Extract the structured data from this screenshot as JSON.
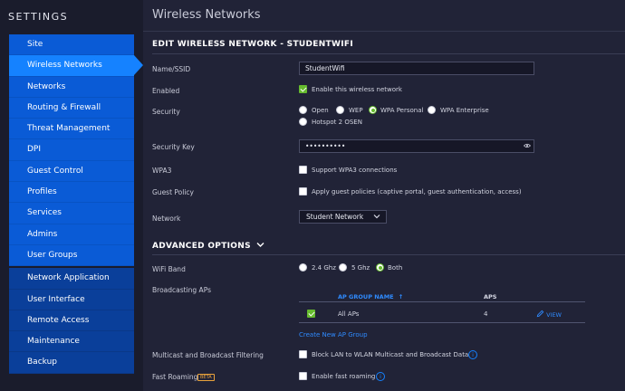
{
  "sidebar": {
    "title": "SETTINGS",
    "items": [
      {
        "label": "Site"
      },
      {
        "label": "Wireless Networks"
      },
      {
        "label": "Networks"
      },
      {
        "label": "Routing & Firewall"
      },
      {
        "label": "Threat Management"
      },
      {
        "label": "DPI"
      },
      {
        "label": "Guest Control"
      },
      {
        "label": "Profiles"
      },
      {
        "label": "Services"
      },
      {
        "label": "Admins"
      },
      {
        "label": "User Groups"
      },
      {
        "label": "Network Application"
      },
      {
        "label": "User Interface"
      },
      {
        "label": "Remote Access"
      },
      {
        "label": "Maintenance"
      },
      {
        "label": "Backup"
      }
    ]
  },
  "page": {
    "title": "Wireless Networks",
    "section_title": "EDIT WIRELESS NETWORK - STUDENTWIFI",
    "advanced_title": "ADVANCED OPTIONS"
  },
  "form": {
    "ssid": {
      "label": "Name/SSID",
      "value": "StudentWifi"
    },
    "enabled": {
      "label": "Enabled",
      "checkbox_label": "Enable this wireless network",
      "checked": true
    },
    "security": {
      "label": "Security",
      "options": [
        "Open",
        "WEP",
        "WPA Personal",
        "WPA Enterprise",
        "Hotspot 2 OSEN"
      ],
      "selected": "WPA Personal"
    },
    "security_key": {
      "label": "Security Key",
      "value": "••••••••••"
    },
    "wpa3": {
      "label": "WPA3",
      "checkbox_label": "Support WPA3 connections",
      "checked": false
    },
    "guest_policy": {
      "label": "Guest Policy",
      "checkbox_label": "Apply guest policies (captive portal, guest authentication, access)",
      "checked": false
    },
    "network": {
      "label": "Network",
      "value": "Student Network"
    }
  },
  "advanced": {
    "wifi_band": {
      "label": "WiFi Band",
      "options": [
        "2.4 Ghz",
        "5 Ghz",
        "Both"
      ],
      "selected": "Both"
    },
    "broadcasting": {
      "label": "Broadcasting APs",
      "columns": [
        "AP GROUP NAME",
        "APS"
      ],
      "rows": [
        {
          "name": "All APs",
          "aps": "4",
          "action": "VIEW",
          "checked": true
        }
      ],
      "create_link": "Create New AP Group"
    },
    "multicast": {
      "label": "Multicast and Broadcast Filtering",
      "checkbox_label": "Block LAN to WLAN Multicast and Broadcast Data",
      "checked": false
    },
    "fast_roaming": {
      "label": "Fast Roaming",
      "badge": "BETA",
      "checkbox_label": "Enable fast roaming",
      "checked": false
    }
  },
  "colors": {
    "background": "#212337",
    "sidebar_blue": "#0a5bd6",
    "active_blue": "#1582ff",
    "accent_green": "#66bb2e",
    "link_blue": "#2f8bff"
  }
}
